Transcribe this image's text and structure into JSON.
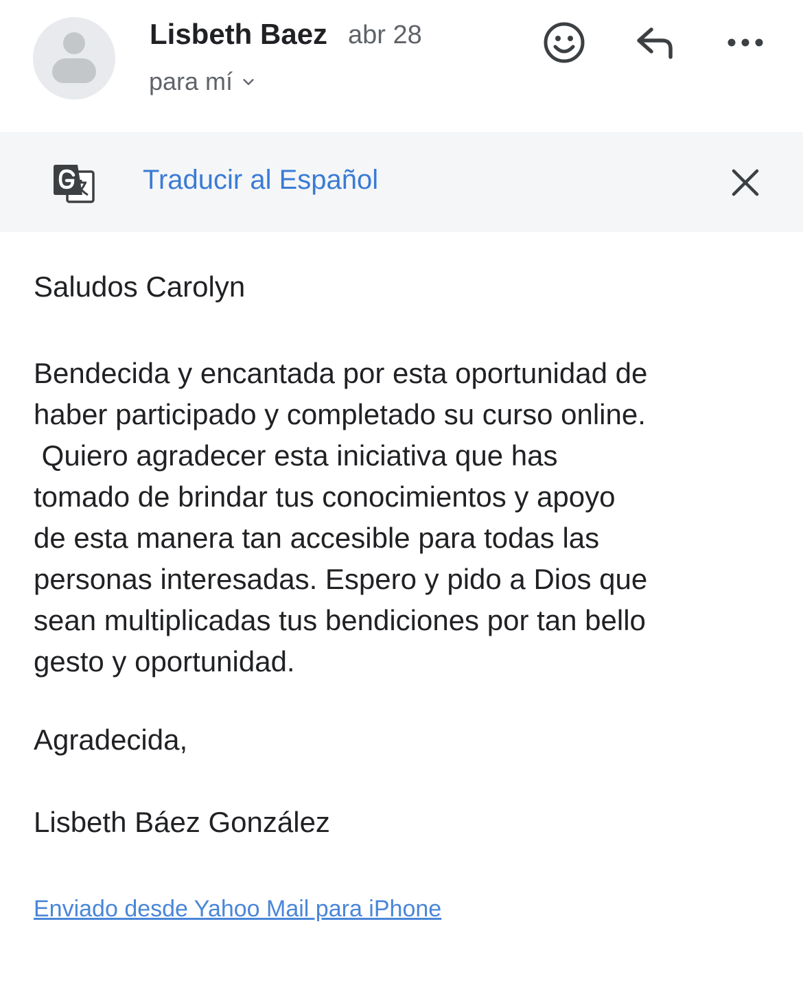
{
  "header": {
    "sender_name": "Lisbeth Baez",
    "date": "abr 28",
    "recipient": "para mí"
  },
  "translate_bar": {
    "link_text": "Traducir al Español"
  },
  "message": {
    "greeting": "Saludos Carolyn",
    "paragraph_lines": [
      "Bendecida y encantada por esta oportunidad de",
      "haber participado y completado su curso online.",
      " Quiero agradecer esta iniciativa que has",
      "tomado de brindar tus conocimientos y apoyo",
      "de esta manera tan accesible para todas las",
      "personas interesadas. Espero y pido a Dios que",
      "sean multiplicadas tus bendiciones por tan bello",
      "gesto y oportunidad."
    ],
    "closing": "Agradecida,",
    "signature": "Lisbeth Báez González",
    "footer_link": "Enviado desde Yahoo Mail para iPhone"
  },
  "icons": {
    "avatar": "person-avatar-icon",
    "recipient_toggle": "chevron-down-icon",
    "emoji": "emoji-smile-icon",
    "reply": "reply-icon",
    "more": "more-horizontal-icon",
    "translate": "google-translate-icon",
    "close": "close-icon"
  },
  "colors": {
    "link_blue": "#3a7bd5",
    "translate_bar_bg": "#f5f6f8",
    "secondary_text": "#5f6368",
    "avatar_bg": "#e8eaed"
  }
}
